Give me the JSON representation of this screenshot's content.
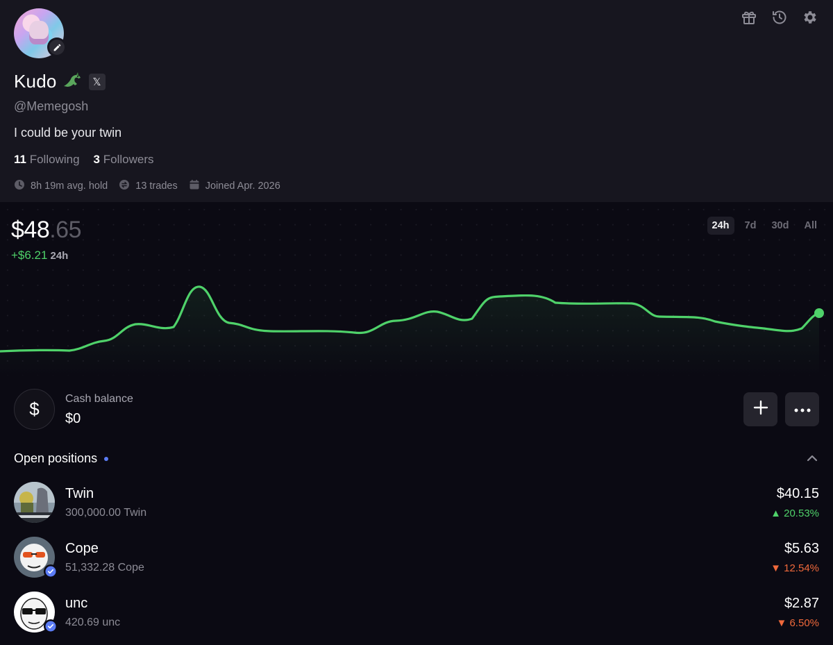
{
  "profile": {
    "name": "Kudo",
    "handle": "@Memegosh",
    "bio": "I could be your twin",
    "following_count": "11",
    "following_label": "Following",
    "followers_count": "3",
    "followers_label": "Followers",
    "avg_hold": "8h 19m avg. hold",
    "trades": "13 trades",
    "joined": "Joined Apr. 2026",
    "x_badge": "𝕏"
  },
  "portfolio": {
    "value_main": "$48",
    "value_cents": ".65",
    "change": "+$6.21",
    "change_period": "24h",
    "ranges": [
      "24h",
      "7d",
      "30d",
      "All"
    ],
    "active_range": "24h"
  },
  "cash": {
    "symbol": "$",
    "label": "Cash balance",
    "value": "$0"
  },
  "positions": {
    "title": "Open positions",
    "items": [
      {
        "name": "Twin",
        "amount": "300,000.00 Twin",
        "value": "$40.15",
        "change": "▲ 20.53%",
        "direction": "up",
        "verified": false
      },
      {
        "name": "Cope",
        "amount": "51,332.28 Cope",
        "value": "$5.63",
        "change": "▼ 12.54%",
        "direction": "down",
        "verified": true
      },
      {
        "name": "unc",
        "amount": "420.69 unc",
        "value": "$2.87",
        "change": "▼ 6.50%",
        "direction": "down",
        "verified": true
      }
    ]
  },
  "colors": {
    "line": "#4fd26a",
    "positive": "#4fd26a",
    "negative": "#f0693b",
    "accent_dot": "#5b7cf5"
  }
}
